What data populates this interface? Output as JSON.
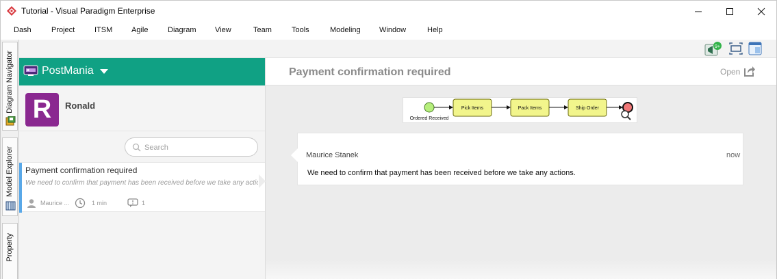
{
  "window": {
    "title": "Tutorial - Visual Paradigm Enterprise",
    "icons": {
      "app": "vp-logo-icon",
      "minimize": "minimize-icon",
      "maximize": "maximize-icon",
      "close": "close-icon"
    }
  },
  "menu": [
    "Dash",
    "Project",
    "ITSM",
    "Agile",
    "Diagram",
    "View",
    "Team",
    "Tools",
    "Modeling",
    "Window",
    "Help"
  ],
  "toolbar": {
    "badge": "9+",
    "icons": [
      "announcements-icon",
      "fit-diagram-icon",
      "layout-panel-icon"
    ]
  },
  "side_tabs": [
    {
      "label": "Diagram Navigator",
      "icon": "diagram-navigator-icon"
    },
    {
      "label": "Model Explorer",
      "icon": "model-explorer-icon"
    },
    {
      "label": "Property",
      "icon": "property-icon"
    }
  ],
  "project": {
    "name": "PostMania",
    "icon": "project-icon",
    "color": "#10a184"
  },
  "user": {
    "initial": "R",
    "name": "Ronald",
    "avatar_color": "#8a2890"
  },
  "search": {
    "placeholder": "Search"
  },
  "discussion_list": [
    {
      "title": "Payment confirmation required",
      "preview": "We need to confirm that payment has been received before we take any actions.",
      "author": "Maurice ...",
      "time": "1 min",
      "comments": "1",
      "accent": "#59a8e8"
    }
  ],
  "discussion": {
    "title": "Payment confirmation required",
    "open_label": "Open",
    "diagram": {
      "start_label": "Ordered Received",
      "tasks": [
        "Pick Items",
        "Pack Items",
        "Ship Order"
      ],
      "task_color": "#f2f58c",
      "start_color": "#b6ef7c",
      "end_color": "#f07777"
    },
    "comment": {
      "author": "Maurice Stanek",
      "time": "now",
      "body": "We need to confirm that payment has been received before we take any actions."
    }
  }
}
